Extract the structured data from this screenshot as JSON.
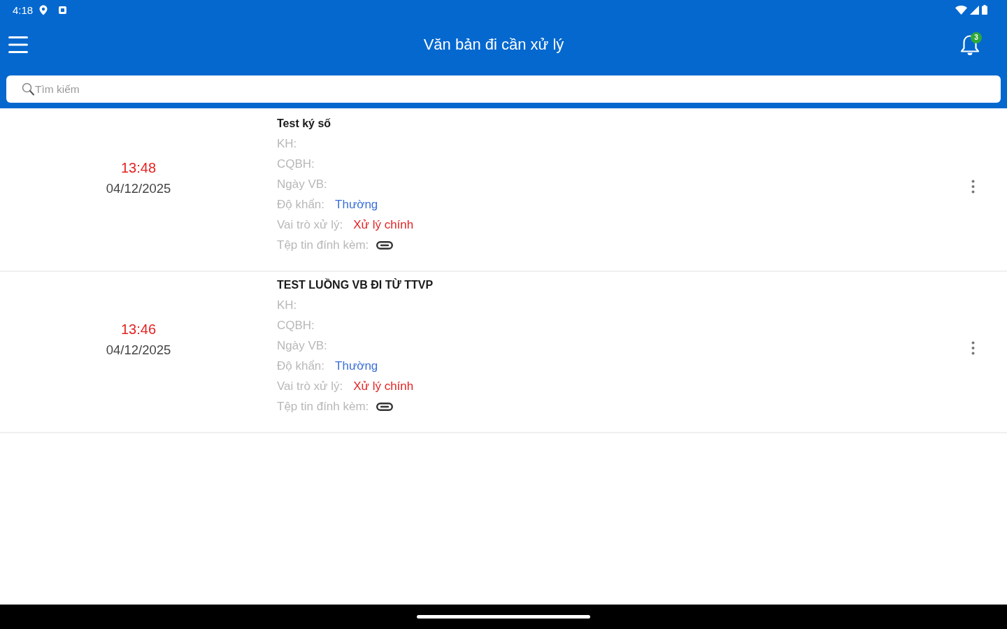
{
  "status_bar": {
    "time": "4:18"
  },
  "app_bar": {
    "title": "Văn bản đi cần xử lý",
    "notification_count": "3"
  },
  "search": {
    "placeholder": "Tìm kiếm"
  },
  "documents": [
    {
      "time": "13:48",
      "date": "04/12/2025",
      "title": "Test ký số",
      "fields": [
        {
          "kind": "text",
          "label": "KH:"
        },
        {
          "kind": "text",
          "label": "CQBH:"
        },
        {
          "kind": "text",
          "label": "Ngày VB:"
        },
        {
          "kind": "tag",
          "label": "Độ khẩn:",
          "value": "Thường",
          "color": "#3a6fd8"
        },
        {
          "kind": "tag",
          "label": "Vai trò xử lý:",
          "value": "Xử lý chính",
          "color": "#e52222"
        },
        {
          "kind": "attachment",
          "label": "Tệp tin đính kèm:"
        }
      ]
    },
    {
      "time": "13:46",
      "date": "04/12/2025",
      "title": "TEST LUỒNG VB ĐI TỪ TTVP",
      "fields": [
        {
          "kind": "text",
          "label": "KH:"
        },
        {
          "kind": "text",
          "label": "CQBH:"
        },
        {
          "kind": "text",
          "label": "Ngày VB:"
        },
        {
          "kind": "tag",
          "label": "Độ khẩn:",
          "value": "Thường",
          "color": "#3a6fd8"
        },
        {
          "kind": "tag",
          "label": "Vai trò xử lý:",
          "value": "Xử lý chính",
          "color": "#e52222"
        },
        {
          "kind": "attachment",
          "label": "Tệp tin đính kèm:"
        }
      ]
    }
  ]
}
